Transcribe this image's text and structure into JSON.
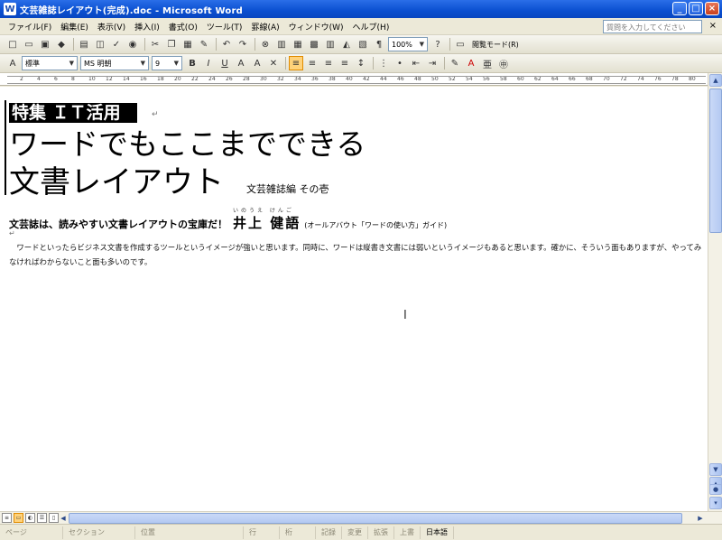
{
  "window": {
    "title": "文芸雑誌レイアウト(完成).doc - Microsoft Word",
    "app_icon": "W",
    "buttons": [
      "_",
      "□",
      "×"
    ]
  },
  "menubar": {
    "items": [
      "ファイル(F)",
      "編集(E)",
      "表示(V)",
      "挿入(I)",
      "書式(O)",
      "ツール(T)",
      "罫線(A)",
      "ウィンドウ(W)",
      "ヘルプ(H)"
    ],
    "help_placeholder": "質問を入力してください",
    "close": "×"
  },
  "toolbar_standard": {
    "zoom": "100%",
    "reading_mode_label": "閲覧モード(R)"
  },
  "toolbar_format": {
    "style": "標準",
    "font": "MS 明朝",
    "size": "9"
  },
  "ruler": {
    "ticks": [
      "2",
      "4",
      "6",
      "8",
      "10",
      "12",
      "14",
      "16",
      "18",
      "20",
      "22",
      "24",
      "26",
      "28",
      "30",
      "32",
      "34",
      "36",
      "38",
      "40",
      "42",
      "44",
      "46",
      "48",
      "50",
      "52",
      "54",
      "56",
      "58",
      "60",
      "62",
      "64",
      "66",
      "68",
      "70",
      "72",
      "74",
      "76",
      "78",
      "80"
    ]
  },
  "document": {
    "section_tag": "特集 ＩＴ活用",
    "title_line1": "ワードでもここまでできる",
    "title_line2": "文書レイアウト",
    "subtitle": "文芸雑誌編 その壱",
    "lead": "文芸誌は、読みやすい文書レイアウトの宝庫だ！",
    "author_ruby": "いのうえ けんご",
    "author_name": "井上 健語",
    "author_credit": "(オールアバウト「ワードの使い方」ガイド)",
    "body": "　ワードといったらビジネス文書を作成するツールというイメージが強いと思います。同時に、ワードは縦書き文書には弱いというイメージもあると思います。確かに、そういう面もありますが、やってみなければわからないこと面も多いのです。"
  },
  "statusbar": {
    "cells": [
      "ページ",
      "セクション",
      "位置",
      "行",
      "桁",
      "記録",
      "変更",
      "拡張",
      "上書",
      "日本語"
    ]
  },
  "colors": {
    "titlebar": "#0a4fd0",
    "chrome": "#ece9d8",
    "active_tool": "#ffd27a"
  }
}
